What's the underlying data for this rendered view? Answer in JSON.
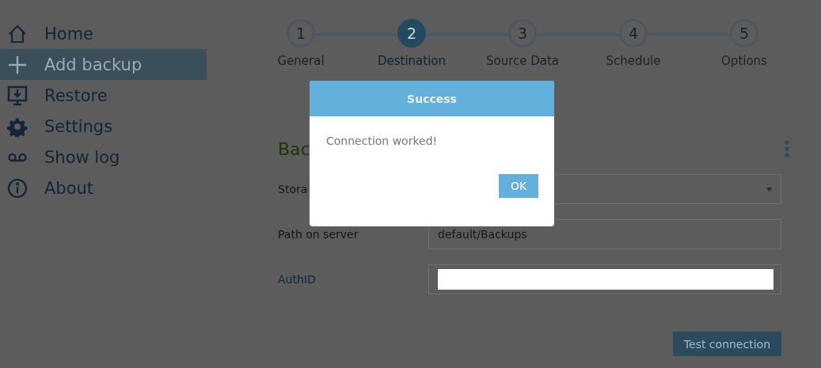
{
  "sidebar": {
    "items": [
      {
        "label": "Home",
        "selected": false
      },
      {
        "label": "Add backup",
        "selected": true
      },
      {
        "label": "Restore",
        "selected": false
      },
      {
        "label": "Settings",
        "selected": false
      },
      {
        "label": "Show log",
        "selected": false
      },
      {
        "label": "About",
        "selected": false
      }
    ]
  },
  "steps": [
    {
      "number": "1",
      "label": "General",
      "selected": false
    },
    {
      "number": "2",
      "label": "Destination",
      "selected": true
    },
    {
      "number": "3",
      "label": "Source Data",
      "selected": false
    },
    {
      "number": "4",
      "label": "Schedule",
      "selected": false
    },
    {
      "number": "5",
      "label": "Options",
      "selected": false
    }
  ],
  "section": {
    "heading": "Bac"
  },
  "fields": [
    {
      "label": "Stora",
      "kind": "select"
    },
    {
      "label": "Path on server",
      "kind": "text",
      "value": "default/Backups"
    },
    {
      "label": "AuthID",
      "kind": "redacted"
    }
  ],
  "test_button": "Test connection",
  "dialog": {
    "title": "Success",
    "message": "Connection worked!",
    "button": "OK"
  }
}
